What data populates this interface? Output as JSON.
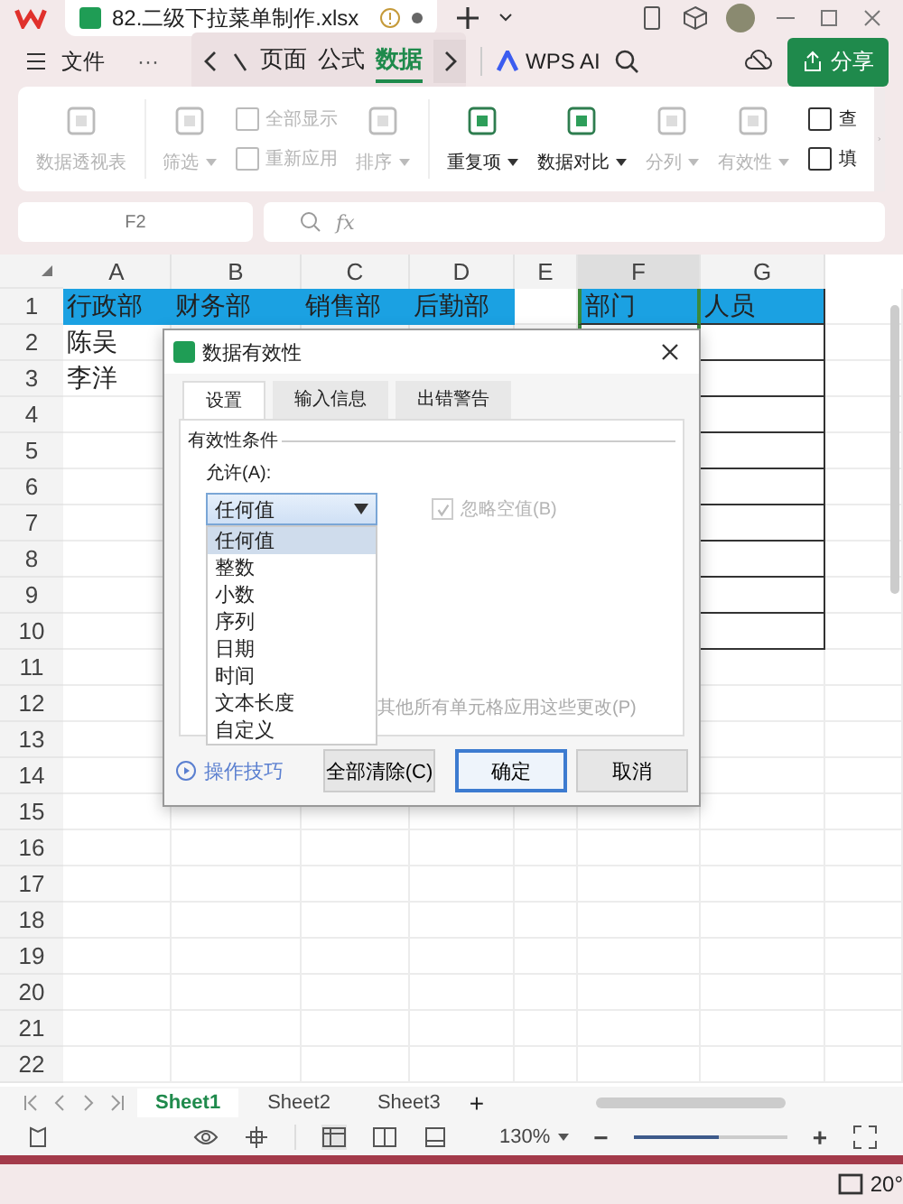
{
  "title_bar": {
    "doc_tab": "82.二级下拉菜单制作.xlsx"
  },
  "menu": {
    "file": "文件",
    "more": "···",
    "tabs": [
      {
        "label": "页面",
        "selected": false
      },
      {
        "label": "公式",
        "selected": false
      },
      {
        "label": "数据",
        "selected": true
      }
    ],
    "ai": "WPS AI",
    "share": "分享"
  },
  "ribbon": [
    {
      "kind": "large",
      "label": "数据透视表",
      "disabled": true,
      "dropdown": false
    },
    {
      "kind": "large",
      "label": "筛选",
      "disabled": true,
      "dropdown": true
    },
    {
      "kind": "pair",
      "labels": [
        "全部显示",
        "重新应用"
      ],
      "disabled": true
    },
    {
      "kind": "large",
      "label": "排序",
      "disabled": true,
      "dropdown": true
    },
    {
      "kind": "large",
      "label": "重复项",
      "disabled": false,
      "dropdown": true
    },
    {
      "kind": "large",
      "label": "数据对比",
      "disabled": false,
      "dropdown": true
    },
    {
      "kind": "large",
      "label": "分列",
      "disabled": true,
      "dropdown": true
    },
    {
      "kind": "large",
      "label": "有效性",
      "disabled": true,
      "dropdown": true
    },
    {
      "kind": "pair",
      "labels": [
        "查",
        "填"
      ],
      "disabled": false
    }
  ],
  "formula_bar": {
    "cell_ref": "F2",
    "fx": "fx"
  },
  "sheet": {
    "columns": [
      {
        "label": "A",
        "selected": false
      },
      {
        "label": "B",
        "selected": false
      },
      {
        "label": "C",
        "selected": false
      },
      {
        "label": "D",
        "selected": false
      },
      {
        "label": "E",
        "selected": false
      },
      {
        "label": "F",
        "selected": true
      },
      {
        "label": "G",
        "selected": false
      }
    ],
    "rows": [
      {
        "number": "1",
        "cells": [
          {
            "text": "行政部",
            "highlighted": true
          },
          {
            "text": "财务部",
            "highlighted": true
          },
          {
            "text": "销售部",
            "highlighted": true
          },
          {
            "text": "后勤部",
            "highlighted": true
          },
          {
            "highlighted": false
          },
          {
            "text": "部门",
            "highlighted": true
          },
          {
            "text": "人员",
            "highlighted": true
          }
        ]
      },
      {
        "number": "2",
        "cells": [
          {
            "text": "陈吴",
            "highlighted": false
          }
        ]
      },
      {
        "number": "3",
        "cells": [
          {
            "text": "李洋",
            "highlighted": false
          }
        ]
      },
      {
        "number": "4"
      },
      {
        "number": "5"
      },
      {
        "number": "6"
      },
      {
        "number": "7"
      },
      {
        "number": "8"
      },
      {
        "number": "9"
      },
      {
        "number": "10"
      },
      {
        "number": "11"
      },
      {
        "number": "12"
      },
      {
        "number": "13"
      },
      {
        "number": "14"
      },
      {
        "number": "15"
      },
      {
        "number": "16"
      },
      {
        "number": "17"
      },
      {
        "number": "18"
      },
      {
        "number": "19"
      },
      {
        "number": "20"
      },
      {
        "number": "21"
      },
      {
        "number": "22"
      }
    ]
  },
  "dialog": {
    "title": "数据有效性",
    "tabs": [
      {
        "label": "设置",
        "selected": true
      },
      {
        "label": "输入信息",
        "selected": false
      },
      {
        "label": "出错警告",
        "selected": false
      }
    ],
    "group_label": "有效性条件",
    "allow_label": "允许(A):",
    "allow_value": "任何值",
    "options": [
      {
        "label": "任何值",
        "selected": true
      },
      {
        "label": "整数",
        "selected": false
      },
      {
        "label": "小数",
        "selected": false
      },
      {
        "label": "序列",
        "selected": false
      },
      {
        "label": "日期",
        "selected": false
      },
      {
        "label": "时间",
        "selected": false
      },
      {
        "label": "文本长度",
        "selected": false
      },
      {
        "label": "自定义",
        "selected": false
      }
    ],
    "ignore_blank": {
      "label": "忽略空值(B)",
      "checked": true,
      "disabled": true
    },
    "apply_text": "其他所有单元格应用这些更改(P)",
    "tips_link": "操作技巧",
    "buttons": [
      {
        "label": "全部清除(C)",
        "kind": "normal"
      },
      {
        "label": "确定",
        "kind": "primary"
      },
      {
        "label": "取消",
        "kind": "normal"
      }
    ]
  },
  "sheet_tabs": [
    {
      "label": "Sheet1",
      "selected": true
    },
    {
      "label": "Sheet2",
      "selected": false
    },
    {
      "label": "Sheet3",
      "selected": false
    }
  ],
  "add_sheet": "+",
  "status_bar": {
    "zoom": "130%",
    "zoom_level": {
      "level": 0.55
    },
    "minus": "−",
    "plus": "+"
  },
  "taskbar": {
    "temperature": "20°"
  }
}
